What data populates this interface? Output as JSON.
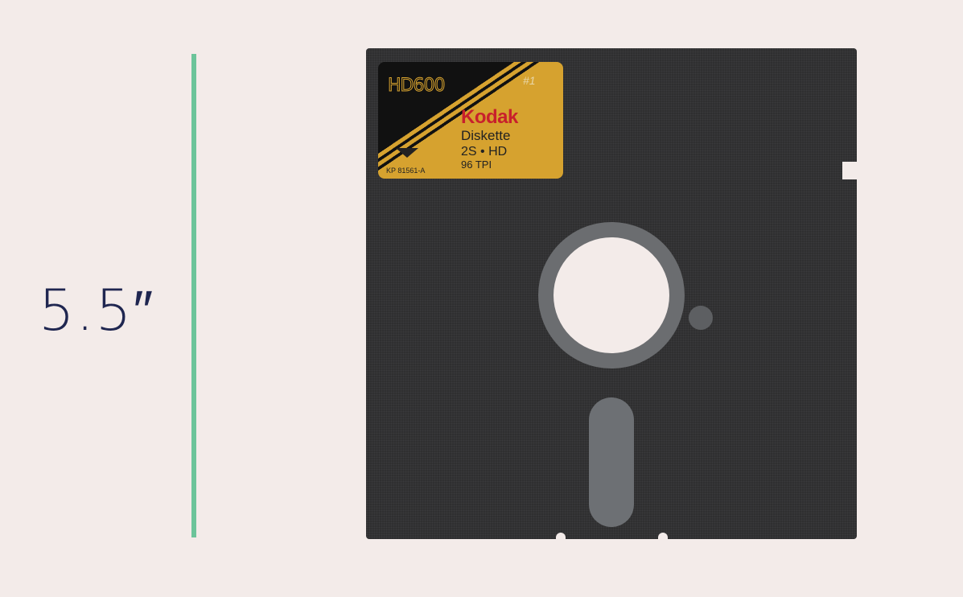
{
  "measurement": "5.5″",
  "label": {
    "model": "HD600",
    "handwritten": "#1",
    "brand": "Kodak",
    "product": "Diskette",
    "density": "2S • HD",
    "tpi": "96 TPI",
    "part_number": "KP 81561-A"
  },
  "colors": {
    "background": "#f3ebe9",
    "ruler": "#6cc49a",
    "text": "#1f2650",
    "disk": "#2f2f30",
    "label": "#d6a22f",
    "brand": "#c8202c"
  }
}
